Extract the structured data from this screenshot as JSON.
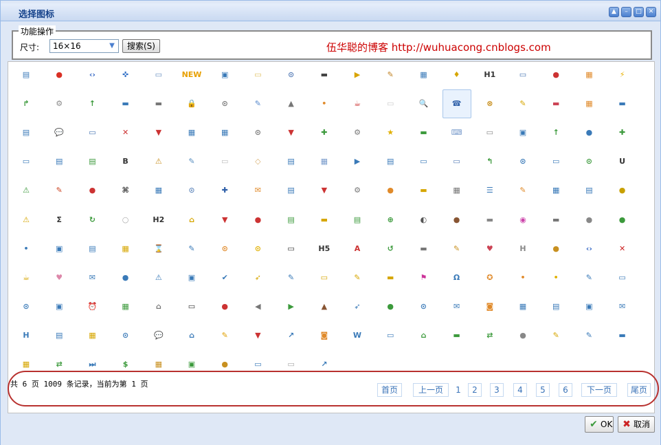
{
  "window": {
    "title": "选择图标"
  },
  "window_buttons": [
    {
      "name": "collapse-button",
      "glyph": "▲"
    },
    {
      "name": "minimize-button",
      "glyph": "–"
    },
    {
      "name": "maximize-button",
      "glyph": "□"
    },
    {
      "name": "close-button",
      "glyph": "✕"
    }
  ],
  "toolbar": {
    "legend": "功能操作",
    "size_label": "尺寸:",
    "size_value": "16×16",
    "search_label": "搜索(S)",
    "blog_text": "伍华聪的博客 http://wuhuacong.cnblogs.com"
  },
  "icons": [
    [
      "▤",
      "●",
      "‹›",
      "✜",
      "▭",
      "NEW",
      "▣",
      "▭",
      "⊙",
      "▬",
      "▶",
      "✎",
      "▦",
      "♦",
      "H1",
      "▭",
      "●",
      "▦",
      "⚡"
    ],
    [
      "↱",
      "⚙",
      "↑",
      "▬",
      "▬",
      "🔒",
      "⊙",
      "✎",
      "▲",
      "•",
      "☕",
      "▭",
      "🔍",
      "☎",
      "⊗",
      "✎",
      "▬",
      "▦",
      "▬"
    ],
    [
      "▤",
      "💬",
      "▭",
      "✕",
      "▼",
      "▦",
      "▦",
      "⊙",
      "▼",
      "✚",
      "⚙",
      "★",
      "▬",
      "⌨",
      "▭",
      "▣",
      "↑",
      "●",
      "✚"
    ],
    [
      "▭",
      "▤",
      "▤",
      "B",
      "⚠",
      "✎",
      "▭",
      "◇",
      "▤",
      "▦",
      "▶",
      "▤",
      "▭",
      "▭",
      "↰",
      "⊙",
      "▭",
      "⊙",
      "U"
    ],
    [
      "⚠",
      "✎",
      "●",
      "⌘",
      "▦",
      "⊙",
      "✚",
      "✉",
      "▤",
      "▼",
      "⚙",
      "●",
      "▬",
      "▦",
      "☰",
      "✎",
      "▦",
      "▤",
      "●"
    ],
    [
      "⚠",
      "Σ",
      "↻",
      "○",
      "H2",
      "⌂",
      "▼",
      "●",
      "▤",
      "▬",
      "▤",
      "⊕",
      "◐",
      "●",
      "▬",
      "◉",
      "▬",
      "●",
      "●"
    ],
    [
      "•",
      "▣",
      "▤",
      "▦",
      "⌛",
      "✎",
      "⊙",
      "⊙",
      "▭",
      "H5",
      "A",
      "↺",
      "▬",
      "✎",
      "♥",
      "H",
      "●",
      "‹›",
      "✕"
    ],
    [
      "☕",
      "♥",
      "✉",
      "●",
      "⚠",
      "▣",
      "✔",
      "➶",
      "✎",
      "▭",
      "✎",
      "▬",
      "⚑",
      "Ω",
      "✪",
      "•",
      "•",
      "✎",
      "▭"
    ],
    [
      "⊙",
      "▣",
      "⏰",
      "▦",
      "⌂",
      "▭",
      "●",
      "◀",
      "▶",
      "▲",
      "➶",
      "●",
      "⊙",
      "✉",
      "◙",
      "▦",
      "▤",
      "▣",
      "✉"
    ],
    [
      "H",
      "▤",
      "▦",
      "⊙",
      "💬",
      "⌂",
      "✎",
      "▼",
      "↗",
      "◙",
      "W",
      "▭",
      "⌂",
      "▬",
      "⇄",
      "●",
      "✎",
      "✎",
      "▬"
    ],
    [
      "▦",
      "⇄",
      "⏭",
      "$",
      "▦",
      "▣",
      "●",
      "▭",
      "▭",
      "↗",
      "",
      "",
      "",
      "",
      "",
      "",
      "",
      "",
      ""
    ]
  ],
  "icon_colors": [
    [
      "#3a7ab8",
      "#d93025",
      "#3467c4",
      "#2e6ec6",
      "#6a8fc0",
      "#e8a000",
      "#3a7ab8",
      "#e0c060",
      "#5a7fb8",
      "#444444",
      "#d8a400",
      "#c08020",
      "#3a7ab8",
      "#d6a600",
      "#333333",
      "#4a77b3",
      "#cc3333",
      "#e08a2a",
      "#e8b000"
    ],
    [
      "#3c9a3c",
      "#888888",
      "#3c9a3c",
      "#3a7ab8",
      "#777777",
      "#d6a600",
      "#777777",
      "#5588cc",
      "#777777",
      "#e08a2a",
      "#cc3333",
      "#cccccc",
      "#3a7ab8",
      "#2e5fa8",
      "#c89020",
      "#d6a600",
      "#cc4455",
      "#e08a2a",
      "#3a7ab8"
    ],
    [
      "#3a7ab8",
      "#3a7ab8",
      "#4a77b3",
      "#cc3333",
      "#cc3333",
      "#3a7ab8",
      "#3a7ab8",
      "#777777",
      "#cc3333",
      "#3c9a3c",
      "#777777",
      "#e0b000",
      "#3c9a3c",
      "#7a9ccc",
      "#888888",
      "#3a7ab8",
      "#3c9a3c",
      "#3a7ab8",
      "#3c9a3c"
    ],
    [
      "#3a7ab8",
      "#3a7ab8",
      "#3c9a3c",
      "#333333",
      "#c89020",
      "#5a8fc0",
      "#bbbbbb",
      "#d8b070",
      "#3a7ab8",
      "#7a9ccc",
      "#3a7ab8",
      "#3a7ab8",
      "#3a7ab8",
      "#5a7fb8",
      "#3c9a3c",
      "#3a7ab8",
      "#3a7ab8",
      "#3c9a3c",
      "#333333"
    ],
    [
      "#3c9a3c",
      "#cc4422",
      "#cc3333",
      "#333333",
      "#3a7ab8",
      "#6a8fc0",
      "#2e5fa8",
      "#e08a2a",
      "#3a7ab8",
      "#cc3333",
      "#777777",
      "#e08a2a",
      "#d6a600",
      "#777777",
      "#3a7ab8",
      "#e08a2a",
      "#3a7ab8",
      "#3a7ab8",
      "#c8a000"
    ],
    [
      "#d6a600",
      "#333333",
      "#3c9a3c",
      "#aaaaaa",
      "#333333",
      "#d6a600",
      "#cc3333",
      "#cc3333",
      "#3c9a3c",
      "#d6a600",
      "#3c9a3c",
      "#3c9a3c",
      "#555555",
      "#885533",
      "#888888",
      "#cc44aa",
      "#777777",
      "#888888",
      "#3c9a3c"
    ],
    [
      "#3a7ab8",
      "#3a7ab8",
      "#3a7ab8",
      "#d6a600",
      "#d8a400",
      "#3a7ab8",
      "#e08a2a",
      "#e0b000",
      "#333333",
      "#333333",
      "#cc3333",
      "#3c9a3c",
      "#777777",
      "#c89020",
      "#cc4455",
      "#888888",
      "#c89020",
      "#3467c4",
      "#cc2222"
    ],
    [
      "#d6a600",
      "#dd88aa",
      "#3a7ab8",
      "#3a7ab8",
      "#3a7ab8",
      "#3a7ab8",
      "#3a7ab8",
      "#d6a600",
      "#3a7ab8",
      "#d6a600",
      "#d6a600",
      "#d6a600",
      "#cc3399",
      "#3a7ab8",
      "#e08a2a",
      "#e08a2a",
      "#e0b000",
      "#3a7ab8",
      "#3a7ab8"
    ],
    [
      "#3a7ab8",
      "#3a7ab8",
      "#3c9a3c",
      "#3c9a3c",
      "#777777",
      "#333333",
      "#cc3333",
      "#777777",
      "#3c9a3c",
      "#885533",
      "#3a7ab8",
      "#3c9a3c",
      "#3a7ab8",
      "#3a7ab8",
      "#e08a2a",
      "#3a7ab8",
      "#3a7ab8",
      "#3a7ab8",
      "#3a7ab8"
    ],
    [
      "#3a7ab8",
      "#3a7ab8",
      "#d6a600",
      "#3a7ab8",
      "#3a7ab8",
      "#3a7ab8",
      "#e0a000",
      "#cc3333",
      "#3a7ab8",
      "#e08a2a",
      "#3a7ab8",
      "#3a7ab8",
      "#3c9a3c",
      "#3c9a3c",
      "#3c9a3c",
      "#888888",
      "#d6a600",
      "#3a7ab8",
      "#3a7ab8"
    ],
    [
      "#d6a600",
      "#3c9a3c",
      "#3a7ab8",
      "#3c9a3c",
      "#c89020",
      "#3c9a3c",
      "#c89020",
      "#3a7ab8",
      "#aaaaaa",
      "#3a7ab8",
      "",
      "",
      "",
      "",
      "",
      "",
      "",
      "",
      ""
    ]
  ],
  "selected_icon": {
    "row": 1,
    "col": 13
  },
  "pager": {
    "info": "共 6 页 1009 条记录，当前为第 1 页",
    "first": "首页",
    "prev": "上一页",
    "pages": [
      "1",
      "2",
      "3",
      "4",
      "5",
      "6"
    ],
    "current_page": "1",
    "next": "下一页",
    "last": "尾页"
  },
  "footer": {
    "ok_label": "OK",
    "cancel_label": "取消"
  },
  "colors": {
    "accent_red": "#cc0000",
    "link_blue": "#3a73b8",
    "frame_blue": "#99bbe8"
  }
}
